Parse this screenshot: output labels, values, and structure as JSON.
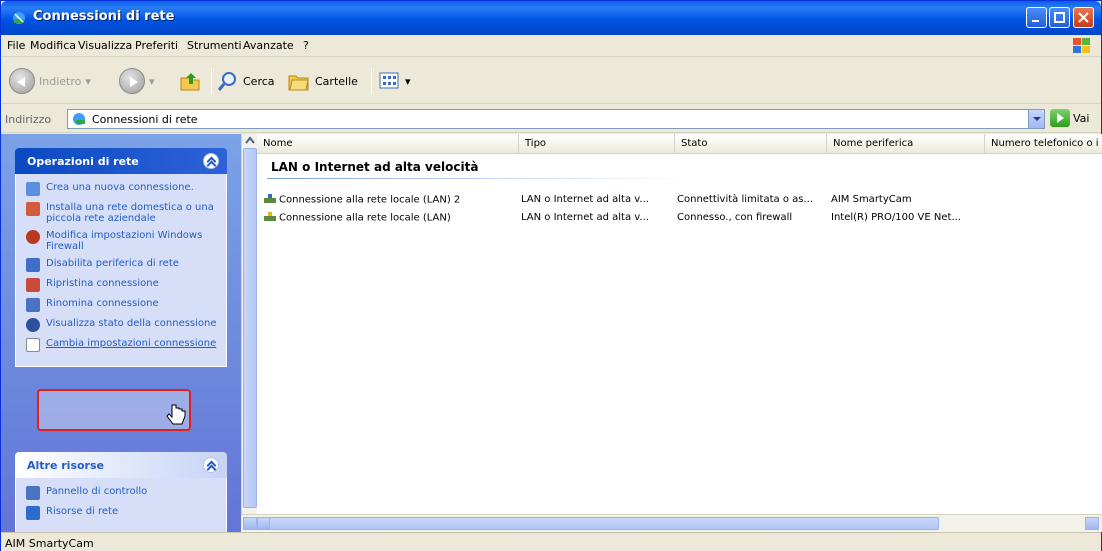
{
  "window": {
    "title": "Connessioni di rete",
    "colors": {
      "titlebar": "#0054e3",
      "taskpane": "#6375d6",
      "highlight": "#e02020"
    }
  },
  "menu": [
    "File",
    "Modifica",
    "Visualizza",
    "Preferiti",
    "Strumenti",
    "Avanzate",
    "?"
  ],
  "toolbar": {
    "back_label": "Indietro",
    "search_label": "Cerca",
    "folders_label": "Cartelle"
  },
  "address": {
    "label": "Indirizzo",
    "value": "Connessioni di rete",
    "go_label": "Vai"
  },
  "taskpane": {
    "network_tasks": {
      "title": "Operazioni di rete",
      "items": [
        {
          "label": "Crea una nuova connessione.",
          "icon": "new-connection-icon"
        },
        {
          "label": "Installa una rete domestica o una piccola rete aziendale",
          "icon": "home-network-icon"
        },
        {
          "label": "Modifica impostazioni Windows Firewall",
          "icon": "firewall-icon"
        },
        {
          "label": "Disabilita periferica di rete",
          "icon": "disable-device-icon"
        },
        {
          "label": "Ripristina connessione",
          "icon": "repair-icon"
        },
        {
          "label": "Rinomina connessione",
          "icon": "rename-icon"
        },
        {
          "label": "Visualizza stato della connessione",
          "icon": "status-icon"
        },
        {
          "label": "Cambia impostazioni connessione",
          "icon": "settings-icon"
        }
      ]
    },
    "other_resources": {
      "title": "Altre risorse",
      "items": [
        {
          "label": "Pannello di controllo",
          "icon": "control-panel-icon"
        },
        {
          "label": "Risorse di rete",
          "icon": "network-places-icon"
        }
      ]
    }
  },
  "list": {
    "columns": [
      "Nome",
      "Tipo",
      "Stato",
      "Nome periferica",
      "Numero telefonico o i"
    ],
    "group": "LAN o Internet ad alta velocità",
    "rows": [
      [
        "Connessione alla rete locale (LAN) 2",
        "LAN o Internet ad alta v...",
        "Connettività limitata o as...",
        "AIM SmartyCam"
      ],
      [
        "Connessione alla rete locale (LAN)",
        "LAN o Internet ad alta v...",
        "Connesso., con firewall",
        "Intel(R) PRO/100 VE Net..."
      ]
    ]
  },
  "status": {
    "text": "AIM SmartyCam"
  }
}
